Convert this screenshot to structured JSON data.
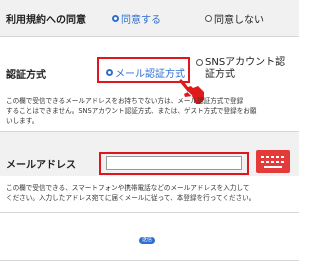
{
  "terms": {
    "label": "利用規約への同意",
    "agree": "同意する",
    "disagree": "同意しない"
  },
  "auth": {
    "label": "認証方式",
    "email_option": "メール認証方式",
    "sns_option_line1": "SNSアカウント認",
    "sns_option_line2": "証方式",
    "note_line1": "この欄で受信できるメールアドレスをお持ちでない方は、メール認証方式で登録",
    "note_line2": "することはできません。SNSアカウント認証方式、または、ゲスト方式で登録をお願",
    "note_line3": "いします。"
  },
  "email": {
    "label": "メールアドレス",
    "value": "",
    "note_line1": "この欄で受信できる、スマートフォンや携帯電話などのメールアドレスを入力して",
    "note_line2": "ください。入力したアドレス宛てに届くメールに従って、本登録を行ってください。"
  },
  "submit_label": "送信",
  "colors": {
    "accent": "#2f6fd0",
    "highlight_red": "#e0151d",
    "band": "#f1f1f1"
  },
  "icons": [
    "pointing-hand-icon",
    "keyboard-icon"
  ]
}
